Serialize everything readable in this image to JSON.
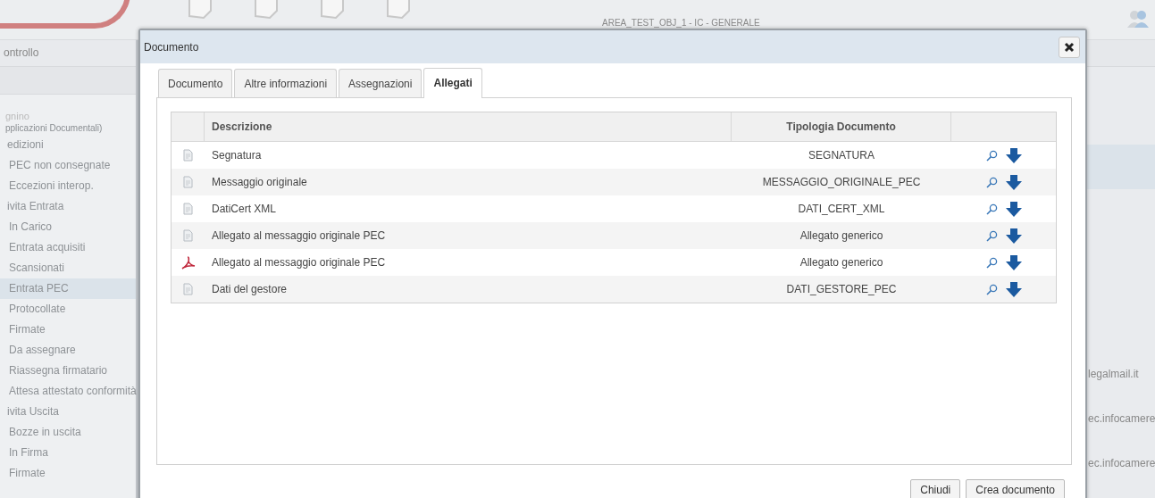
{
  "header": {
    "area_label": "AREA_TEST_OBJ_1 - IC - GENERALE"
  },
  "sidebar": {
    "title": "ontrollo",
    "headings": [
      "gnino",
      "pplicazioni Documentali)"
    ],
    "items": [
      {
        "label": "edizioni",
        "selected": false,
        "children": [
          {
            "label": "PEC non consegnate",
            "selected": false
          },
          {
            "label": "Eccezioni interop.",
            "selected": false
          }
        ]
      },
      {
        "label": "ivita Entrata",
        "selected": false,
        "children": [
          {
            "label": "In Carico",
            "selected": false
          },
          {
            "label": "Entrata acquisiti",
            "selected": false
          },
          {
            "label": "Scansionati",
            "selected": false
          },
          {
            "label": "Entrata PEC",
            "selected": true
          },
          {
            "label": "Protocollate",
            "selected": false
          },
          {
            "label": "Firmate",
            "selected": false
          },
          {
            "label": "Da assegnare",
            "selected": false
          },
          {
            "label": "Riassegna firmatario",
            "selected": false
          },
          {
            "label": "Attesa attestato conformità",
            "selected": false
          }
        ]
      },
      {
        "label": "ivita Uscita",
        "selected": false,
        "children": [
          {
            "label": "Bozze in uscita",
            "selected": false
          },
          {
            "label": "In Firma",
            "selected": false
          },
          {
            "label": "Firmate",
            "selected": false
          }
        ]
      }
    ]
  },
  "background_list": [
    "legalmail.it",
    "ec.infocamere",
    "ec.infocamere"
  ],
  "dialog": {
    "title": "Documento",
    "tabs": [
      {
        "label": "Documento",
        "selected": false
      },
      {
        "label": "Altre informazioni",
        "selected": false
      },
      {
        "label": "Assegnazioni",
        "selected": false
      },
      {
        "label": "Allegati",
        "selected": true
      }
    ],
    "table": {
      "columns": [
        "Descrizione",
        "Tipologia Documento"
      ],
      "rows": [
        {
          "kind": "file",
          "description": "Segnatura",
          "type": "SEGNATURA"
        },
        {
          "kind": "file",
          "description": "Messaggio originale",
          "type": "MESSAGGIO_ORIGINALE_PEC"
        },
        {
          "kind": "file",
          "description": "DatiCert XML",
          "type": "DATI_CERT_XML"
        },
        {
          "kind": "file",
          "description": "Allegato al messaggio originale PEC",
          "type": "Allegato generico"
        },
        {
          "kind": "pdf",
          "description": "Allegato al messaggio originale PEC",
          "type": "Allegato generico"
        },
        {
          "kind": "file",
          "description": "Dati del gestore",
          "type": "DATI_GESTORE_PEC"
        }
      ]
    },
    "buttons": [
      "Chiudi",
      "Crea documento"
    ]
  }
}
